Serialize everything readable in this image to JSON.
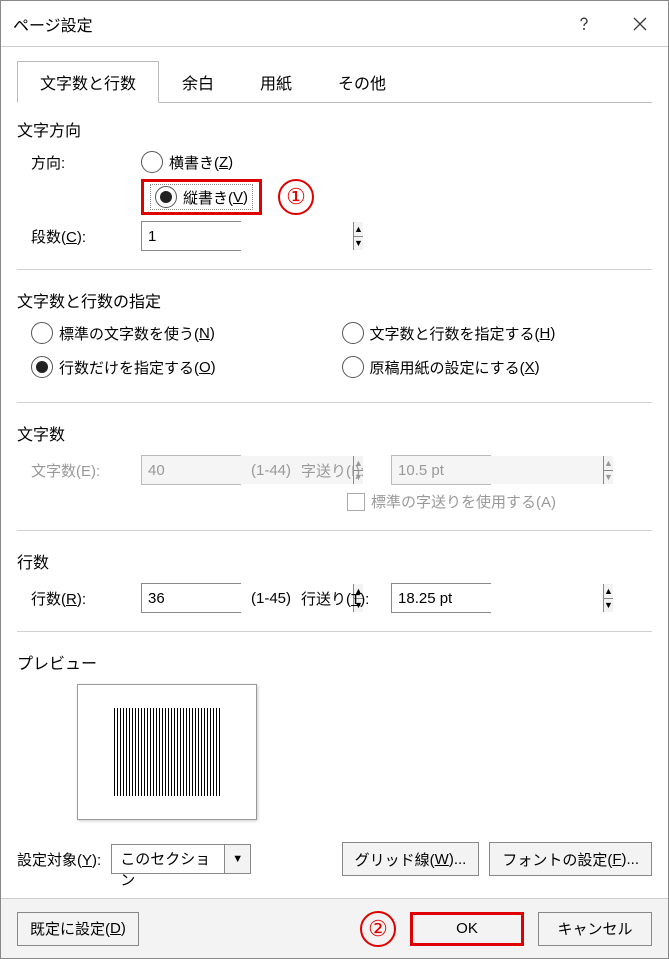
{
  "titlebar": {
    "title": "ページ設定"
  },
  "tabs": [
    "文字数と行数",
    "余白",
    "用紙",
    "その他"
  ],
  "active_tab": 0,
  "text_direction": {
    "section": "文字方向",
    "label": "方向:",
    "horizontal": "横書き(",
    "horizontal_u": "Z",
    "horizontal_end": ")",
    "vertical": "縦書き(",
    "vertical_u": "V",
    "vertical_end": ")",
    "selected": "vertical",
    "columns_label_pre": "段数(",
    "columns_u": "C",
    "columns_label_post": "):",
    "columns_value": "1"
  },
  "spec": {
    "section": "文字数と行数の指定",
    "opt1_pre": "標準の文字数を使う(",
    "opt1_u": "N",
    "opt1_post": ")",
    "opt2_pre": "文字数と行数を指定する(",
    "opt2_u": "H",
    "opt2_post": ")",
    "opt3_pre": "行数だけを指定する(",
    "opt3_u": "O",
    "opt3_post": ")",
    "opt4_pre": "原稿用紙の設定にする(",
    "opt4_u": "X",
    "opt4_post": ")",
    "selected": "opt3"
  },
  "chars": {
    "section": "文字数",
    "count_label": "文字数(E):",
    "count_value": "40",
    "count_range": "(1-44)",
    "pitch_label": "字送り(I):",
    "pitch_value": "10.5 pt",
    "default_pitch": "標準の字送りを使用する(A)"
  },
  "lines": {
    "section": "行数",
    "count_label_pre": "行数(",
    "count_u": "R",
    "count_label_post": "):",
    "count_value": "36",
    "count_range": "(1-45)",
    "pitch_label_pre": "行送り(",
    "pitch_u": "T",
    "pitch_label_post": "):",
    "pitch_value": "18.25 pt"
  },
  "preview": {
    "section": "プレビュー"
  },
  "apply": {
    "label_pre": "設定対象(",
    "label_u": "Y",
    "label_post": "):",
    "value": "このセクション",
    "grid_pre": "グリッド線(",
    "grid_u": "W",
    "grid_post": ")...",
    "font_pre": "フォントの設定(",
    "font_u": "F",
    "font_post": ")..."
  },
  "footer": {
    "default_pre": "既定に設定(",
    "default_u": "D",
    "default_post": ")",
    "ok": "OK",
    "cancel": "キャンセル"
  },
  "callouts": {
    "one": "①",
    "two": "②"
  }
}
